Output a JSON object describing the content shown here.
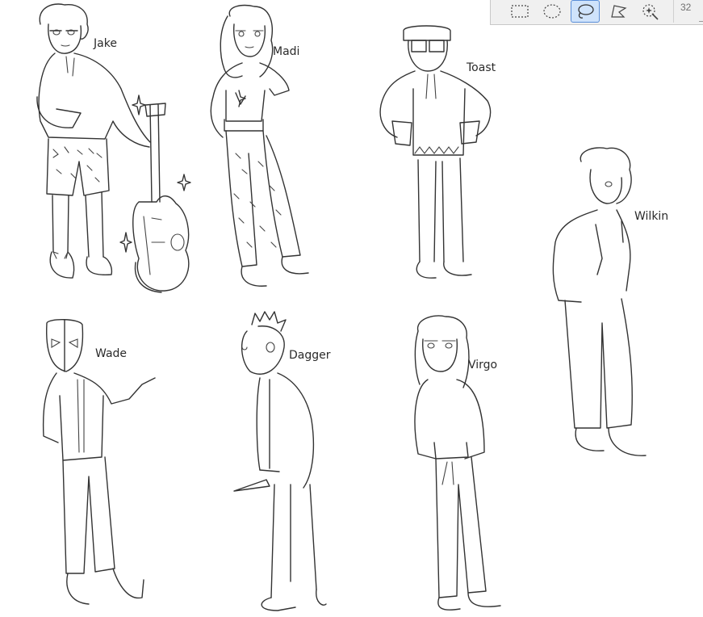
{
  "toolbar": {
    "tools": [
      {
        "id": "rect-select",
        "icon": "rectangle-select-icon",
        "active": false
      },
      {
        "id": "ellipse-select",
        "icon": "ellipse-select-icon",
        "active": false
      },
      {
        "id": "lasso-select",
        "icon": "lasso-select-icon",
        "active": true
      },
      {
        "id": "polygon-select",
        "icon": "polygon-lasso-icon",
        "active": false
      },
      {
        "id": "magic-select",
        "icon": "magic-wand-select-icon",
        "active": false
      }
    ],
    "brush_size": "32",
    "accent_color": "#5a8ed8"
  },
  "characters": [
    {
      "name": "Jake"
    },
    {
      "name": "Madi"
    },
    {
      "name": "Toast"
    },
    {
      "name": "Wilkin"
    },
    {
      "name": "Wade"
    },
    {
      "name": "Dagger"
    },
    {
      "name": "Virgo"
    }
  ]
}
